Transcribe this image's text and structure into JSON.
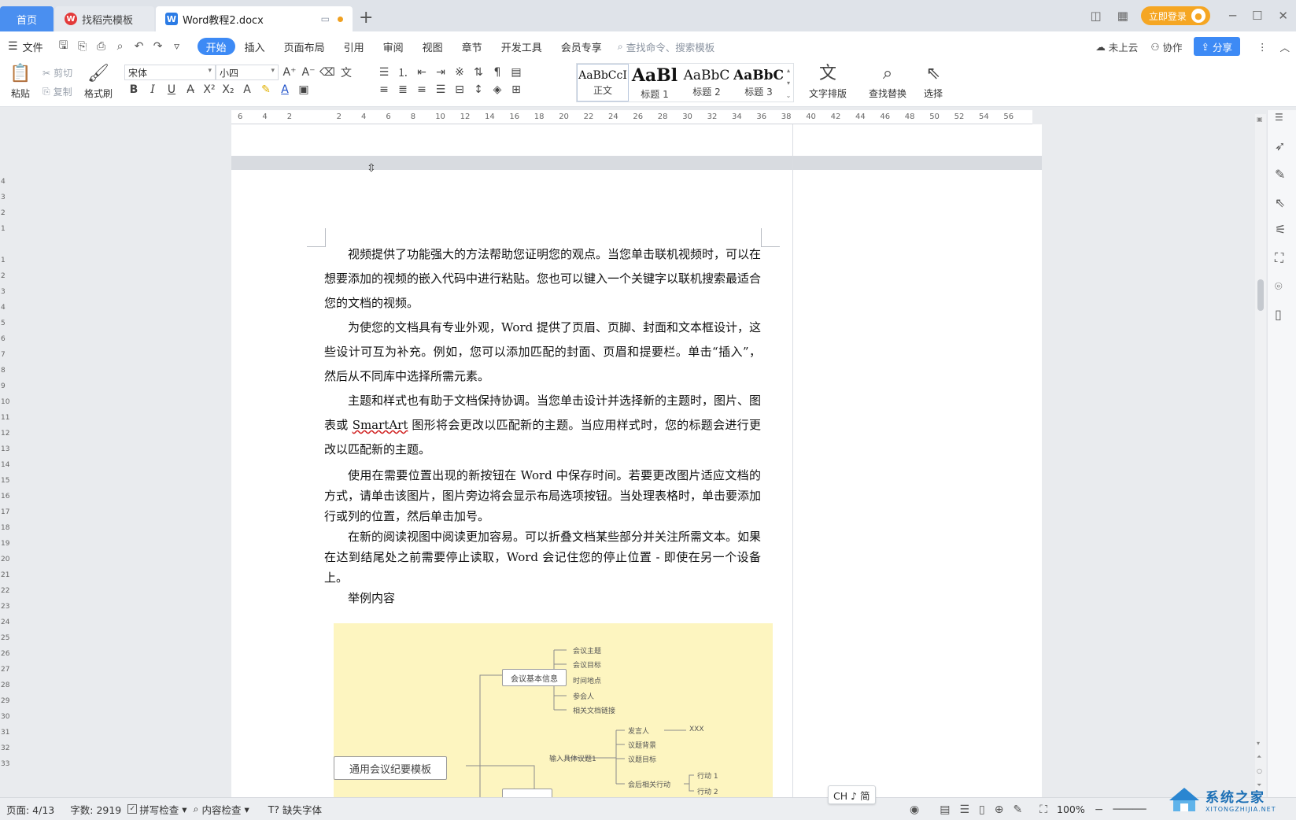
{
  "tabs": {
    "home": "首页",
    "template": "找稻壳模板",
    "document": "Word教程2.docx",
    "add": "+"
  },
  "window": {
    "login": "立即登录"
  },
  "menu": {
    "file": "文件",
    "items": [
      "开始",
      "插入",
      "页面布局",
      "引用",
      "审阅",
      "视图",
      "章节",
      "开发工具",
      "会员专享"
    ],
    "search_placeholder": "查找命令、搜索模板",
    "cloud": "未上云",
    "collab": "协作",
    "share": "分享"
  },
  "ribbon": {
    "paste": "粘贴",
    "cut": "剪切",
    "copy": "复制",
    "format_painter": "格式刷",
    "font_name": "宋体",
    "font_size": "小四",
    "styles": [
      {
        "preview": "AaBbCcI",
        "name": "正文"
      },
      {
        "preview": "AaBl",
        "name": "标题 1"
      },
      {
        "preview": "AaBbC",
        "name": "标题 2"
      },
      {
        "preview": "AaBbC",
        "name": "标题 3"
      }
    ],
    "text_layout": "文字排版",
    "find_replace": "查找替换",
    "select": "选择"
  },
  "ruler": {
    "h_ticks": [
      "6",
      "4",
      "2",
      "",
      "2",
      "4",
      "6",
      "8",
      "10",
      "12",
      "14",
      "16",
      "18",
      "20",
      "22",
      "24",
      "26",
      "28",
      "30",
      "32",
      "34",
      "36",
      "38",
      "40",
      "42",
      "44",
      "46",
      "48",
      "50",
      "52",
      "54",
      "56"
    ],
    "v_ticks": [
      "4",
      "3",
      "2",
      "1",
      "",
      "1",
      "2",
      "3",
      "4",
      "5",
      "6",
      "7",
      "8",
      "9",
      "10",
      "11",
      "12",
      "13",
      "14",
      "15",
      "16",
      "17",
      "18",
      "19",
      "20",
      "21",
      "22",
      "23",
      "24",
      "25",
      "26",
      "27",
      "28",
      "29",
      "30",
      "31",
      "32",
      "33"
    ]
  },
  "document": {
    "paragraphs": [
      {
        "text": "视频提供了功能强大的方法帮助您证明您的观点。当您单击联机视频时，可以在想要添加的视频的嵌入代码中进行粘贴。您也可以键入一个关键字以联机搜索最适合您的文档的视频。",
        "style": "loose"
      },
      {
        "text": "为使您的文档具有专业外观，Word 提供了页眉、页脚、封面和文本框设计，这些设计可互为补充。例如，您可以添加匹配的封面、页眉和提要栏。单击“插入”，然后从不同库中选择所需元素。",
        "style": "loose"
      },
      {
        "text_before": "主题和样式也有助于文档保持协调。当您单击设计并选择新的主题时，图片、图表或 ",
        "smartart": "SmartArt",
        "text_after": " 图形将会更改以匹配新的主题。当应用样式时，您的标题会进行更改以匹配新的主题。",
        "style": "loose"
      },
      {
        "text": "使用在需要位置出现的新按钮在 Word 中保存时间。若要更改图片适应文档的方式，请单击该图片，图片旁边将会显示布局选项按钮。当处理表格时，单击要添加行或列的位置，然后单击加号。",
        "style": "tight"
      },
      {
        "text": "在新的阅读视图中阅读更加容易。可以折叠文档某些部分并关注所需文本。如果在达到结尾处之前需要停止读取，Word 会记住您的停止位置 - 即使在另一个设备上。",
        "style": "tight"
      },
      {
        "text": "举例内容",
        "style": "tight"
      }
    ]
  },
  "mindmap": {
    "root": "通用会议纪要模板",
    "branch1": "会议基本信息",
    "branch1_leaves": [
      "会议主题",
      "会议目标",
      "时间地点",
      "参会人",
      "相关文档链接"
    ],
    "branch2": "输入具体议题1",
    "branch2_leaves": [
      "发言人",
      "议题背景",
      "议题目标",
      "会后相关行动"
    ],
    "speaker_value": "XXX",
    "actions": [
      "行动 1",
      "行动 2"
    ]
  },
  "status": {
    "page": "页面: 4/13",
    "words": "字数: 2919",
    "spell": "拼写检查",
    "content": "内容检查",
    "missing_font": "缺失字体",
    "zoom": "100%",
    "ime": "CH ♪ 简"
  },
  "watermark": {
    "cn": "系统之家",
    "en": "XITONGZHIJIA.NET"
  },
  "colors": {
    "accent": "#3d8af5",
    "login": "#f5a623",
    "mindmap_bg": "#fdf5c0"
  }
}
